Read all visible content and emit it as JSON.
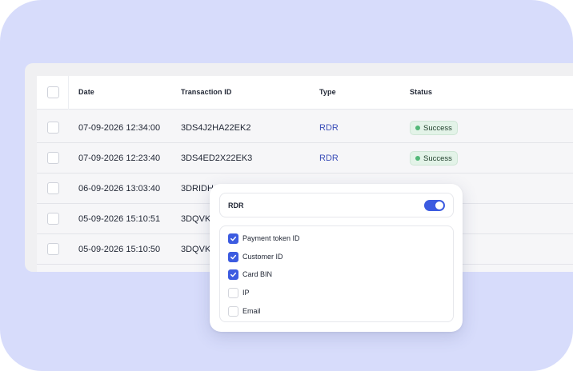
{
  "colors": {
    "accent": "#3c5be0",
    "success": "#52b877",
    "background": "#d7dcfb"
  },
  "table": {
    "headers": {
      "date": "Date",
      "transaction_id": "Transaction ID",
      "type": "Type",
      "status": "Status"
    },
    "rows": [
      {
        "date": "07-09-2026 12:34:00",
        "id": "3DS4J2HA22EK2",
        "type": "RDR",
        "status": "Success"
      },
      {
        "date": "07-09-2026 12:23:40",
        "id": "3DS4ED2X22EK3",
        "type": "RDR",
        "status": "Success"
      },
      {
        "date": "06-09-2026 13:03:40",
        "id": "3DRIDH",
        "type": "",
        "status": ""
      },
      {
        "date": "05-09-2026 15:10:51",
        "id": "3DQVK",
        "type": "",
        "status": ""
      },
      {
        "date": "05-09-2026 15:10:50",
        "id": "3DQVK",
        "type": "",
        "status": ""
      }
    ]
  },
  "popover": {
    "title": "RDR",
    "toggle_on": true,
    "options": [
      {
        "label": "Payment token ID",
        "checked": true
      },
      {
        "label": "Customer ID",
        "checked": true
      },
      {
        "label": "Card BIN",
        "checked": true
      },
      {
        "label": "IP",
        "checked": false
      },
      {
        "label": "Email",
        "checked": false
      }
    ]
  }
}
